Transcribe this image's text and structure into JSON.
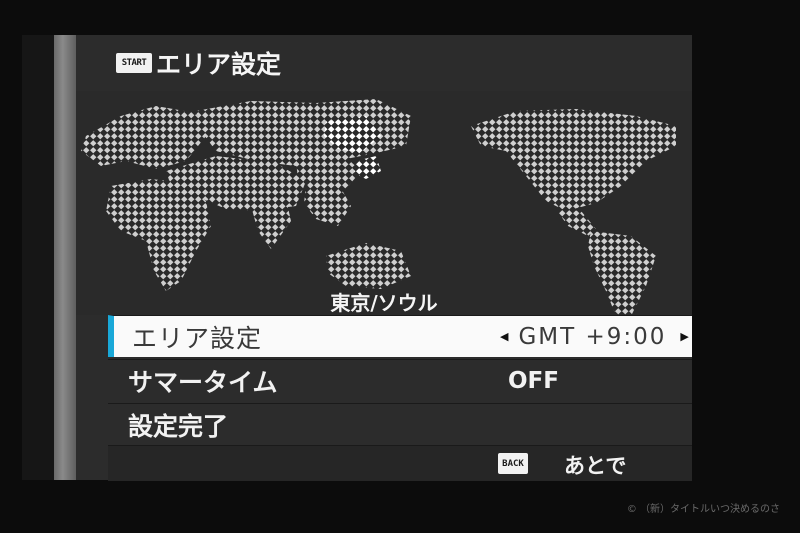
{
  "header": {
    "start_icon": "START",
    "title": "エリア設定"
  },
  "map": {
    "selected_city": "東京/ソウル"
  },
  "menu": {
    "items": [
      {
        "label": "エリア設定",
        "value": "GMT +9:00",
        "selected": true
      },
      {
        "label": "サマータイム",
        "value": "OFF",
        "selected": false
      },
      {
        "label": "設定完了",
        "value": "",
        "selected": false
      }
    ]
  },
  "footer": {
    "back_icon": "BACK",
    "back_label": "あとで"
  },
  "watermark": "© （新）タイトルいつ決めるのさ",
  "colors": {
    "accent": "#19a8d8",
    "selected_row_bg": "#fafafa",
    "screen_bg": "#2c2c2c"
  }
}
